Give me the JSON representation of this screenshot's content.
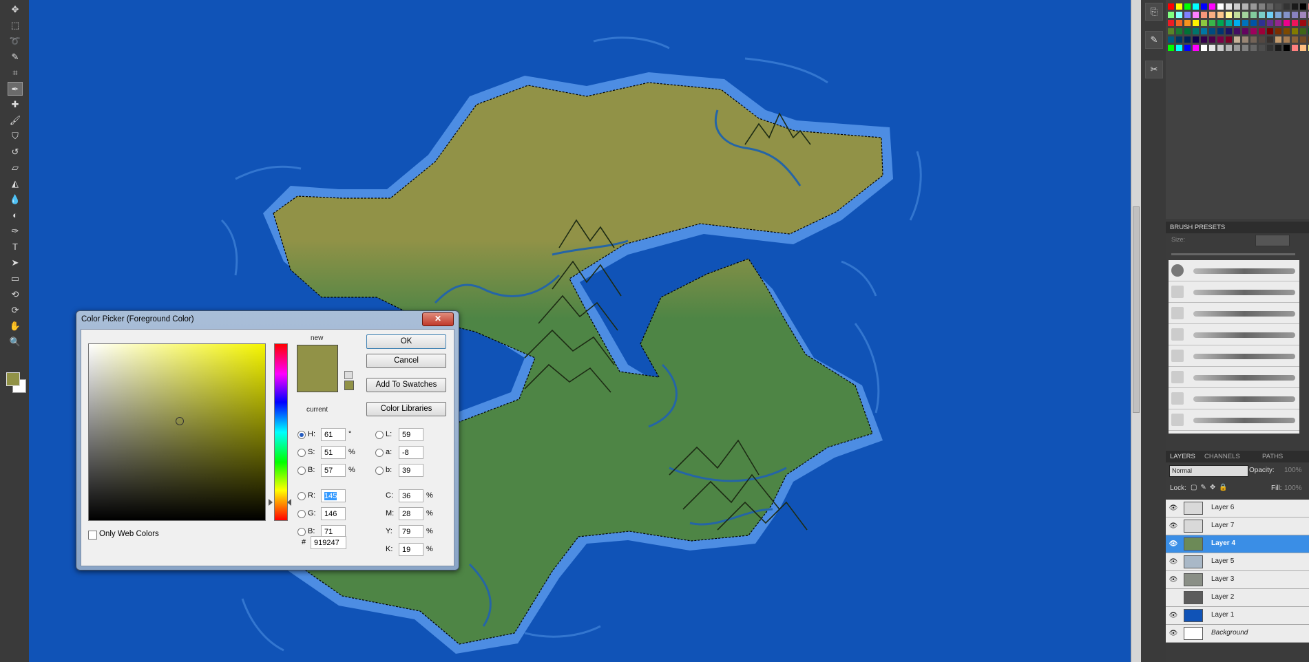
{
  "colors": {
    "ocean": "#1053b7",
    "shore": "#4d8de3",
    "land_green": "#4e8545",
    "land_olive": "#919247",
    "river": "#2565a6",
    "selected_color": "#919247",
    "selected_layer": "#3a8ee6"
  },
  "toolbox": {
    "tools": [
      "move-icon",
      "marquee-icon",
      "lasso-icon",
      "quick-select-icon",
      "crop-icon",
      "eyedropper-icon",
      "healing-brush-icon",
      "brush-icon",
      "clone-stamp-icon",
      "history-brush-icon",
      "eraser-icon",
      "paint-bucket-icon",
      "blur-icon",
      "dodge-icon",
      "pen-icon",
      "type-icon",
      "path-select-icon",
      "shape-icon",
      "3d-rotate-icon",
      "3d-orbit-icon",
      "hand-icon",
      "zoom-icon"
    ]
  },
  "panels": {
    "brush_presets_tab": "BRUSH PRESETS",
    "brush_size_label": "Size:",
    "layers_tab": "LAYERS",
    "channels_tab": "CHANNELS",
    "paths_tab": "PATHS",
    "blend_mode": "Normal",
    "opacity_label": "Opacity:",
    "opacity_value": "100%",
    "lock_label": "Lock:",
    "fill_label": "Fill:",
    "fill_value": "100%",
    "layers": [
      {
        "name": "Layer 6",
        "visible": true
      },
      {
        "name": "Layer 7",
        "visible": true
      },
      {
        "name": "Layer 4",
        "visible": true,
        "selected": true
      },
      {
        "name": "Layer 5",
        "visible": true
      },
      {
        "name": "Layer 3",
        "visible": true
      },
      {
        "name": "Layer 2",
        "visible": false
      },
      {
        "name": "Layer 1",
        "visible": true
      },
      {
        "name": "Background",
        "visible": true
      }
    ]
  },
  "dialog": {
    "title": "Color Picker (Foreground Color)",
    "close_glyph": "✕",
    "new_label": "new",
    "current_label": "current",
    "ok": "OK",
    "cancel": "Cancel",
    "add_to_swatches": "Add To Swatches",
    "color_libraries": "Color Libraries",
    "only_web_colors": "Only Web Colors",
    "hex_label": "#",
    "hex": "919247",
    "hsb": {
      "H": "61",
      "S": "51",
      "B": "57",
      "H_unit": "°",
      "pct": "%"
    },
    "rgb": {
      "R": "145",
      "G": "146",
      "B": "71"
    },
    "lab": {
      "L": "59",
      "a": "-8",
      "b": "39"
    },
    "cmyk": {
      "C": "36",
      "M": "28",
      "Y": "79",
      "K": "19"
    },
    "labels": {
      "H": "H:",
      "S": "S:",
      "B": "B:",
      "R": "R:",
      "G": "G:",
      "Bb": "B:",
      "L": "L:",
      "a": "a:",
      "b": "b:",
      "C": "C:",
      "M": "M:",
      "Y": "Y:",
      "K": "K:"
    }
  }
}
